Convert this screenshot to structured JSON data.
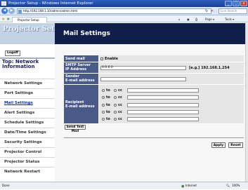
{
  "window": {
    "title": "Projector Setup - Windows Internet Explorer"
  },
  "browser": {
    "address": "http://192.168.1.10/admin/admin.html",
    "search_placeholder": "Live Search",
    "tab_label": "Projector Setup",
    "toolbar": {
      "page": "Page ▾",
      "tools": "Tools ▾"
    }
  },
  "sidebar": {
    "logo": "Projector Setup",
    "logoff": "Logoff",
    "top_link": "Top: Network Information",
    "items": [
      {
        "label": "Network Settings"
      },
      {
        "label": "Port Settings"
      },
      {
        "label": "Mail Settings"
      },
      {
        "label": "Alert Settings"
      },
      {
        "label": "Schedule Settings"
      },
      {
        "label": "Date/Time Settings"
      },
      {
        "label": "Security Settings"
      },
      {
        "label": "Projector Control"
      },
      {
        "label": "Projector Status"
      },
      {
        "label": "Network Restart"
      }
    ]
  },
  "main": {
    "title": "Mail Settings",
    "send_mail": {
      "label": "Send mail",
      "checkbox_label": "Enable",
      "checked": false
    },
    "smtp": {
      "label": "SMTP Server IP Address",
      "value": "0.0.0.0",
      "hint": "[e.g.] 192.168.1.254"
    },
    "sender": {
      "label": "Sender E-mail address",
      "value": ""
    },
    "recipient": {
      "label": "Recipient E-mail address",
      "rows": [
        {
          "to": "to",
          "cc": "cc",
          "value": ""
        },
        {
          "to": "to",
          "cc": "cc",
          "value": ""
        },
        {
          "to": "to",
          "cc": "cc",
          "value": ""
        },
        {
          "to": "to",
          "cc": "cc",
          "value": ""
        },
        {
          "to": "to",
          "cc": "cc",
          "value": ""
        }
      ]
    },
    "send_test_button": "Send Test Mail",
    "apply_button": "Apply",
    "reset_button": "Reset"
  },
  "statusbar": {
    "left": "Done",
    "zone": "Internet",
    "zoom": "100%"
  }
}
